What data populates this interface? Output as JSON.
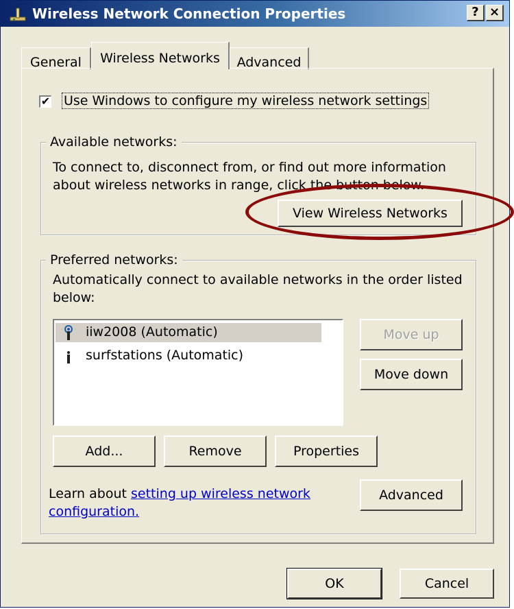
{
  "window": {
    "title": "Wireless Network Connection Properties",
    "help_button": "?",
    "close_button": "×",
    "icon": "network-connection-icon"
  },
  "tabs": [
    {
      "label": "General",
      "active": false
    },
    {
      "label": "Wireless Networks",
      "active": true
    },
    {
      "label": "Advanced",
      "active": false
    }
  ],
  "use_windows_checkbox": {
    "label": "Use Windows to configure my wireless network settings",
    "checked": true
  },
  "available_networks": {
    "group_label": "Available networks:",
    "description_line1": "To connect to, disconnect from, or find out more information",
    "description_line2": "about wireless networks in range, click the button below.",
    "view_button": "View Wireless Networks"
  },
  "preferred_networks": {
    "group_label": "Preferred networks:",
    "description_line1": "Automatically connect to available networks in the order listed",
    "description_line2": "below:",
    "networks": [
      {
        "label": "iiw2008 (Automatic)",
        "icon": "wireless-antenna-active-icon",
        "selected": true
      },
      {
        "label": "surfstations (Automatic)",
        "icon": "wireless-antenna-icon",
        "selected": false
      }
    ],
    "move_up_button": "Move up",
    "move_down_button": "Move down",
    "add_button": "Add...",
    "remove_button": "Remove",
    "properties_button": "Properties",
    "learn_text": "Learn about ",
    "learn_link_line1": "setting up wireless network",
    "learn_link_line2": "configuration.",
    "advanced_button": "Advanced"
  },
  "footer": {
    "ok_button": "OK",
    "cancel_button": "Cancel"
  },
  "colors": {
    "titlebar_start": "#0a246a",
    "titlebar_end": "#a6caf0",
    "dialog_background": "#ece9d8",
    "annotation_ellipse": "#8b0a0a",
    "link": "#0000cc"
  }
}
